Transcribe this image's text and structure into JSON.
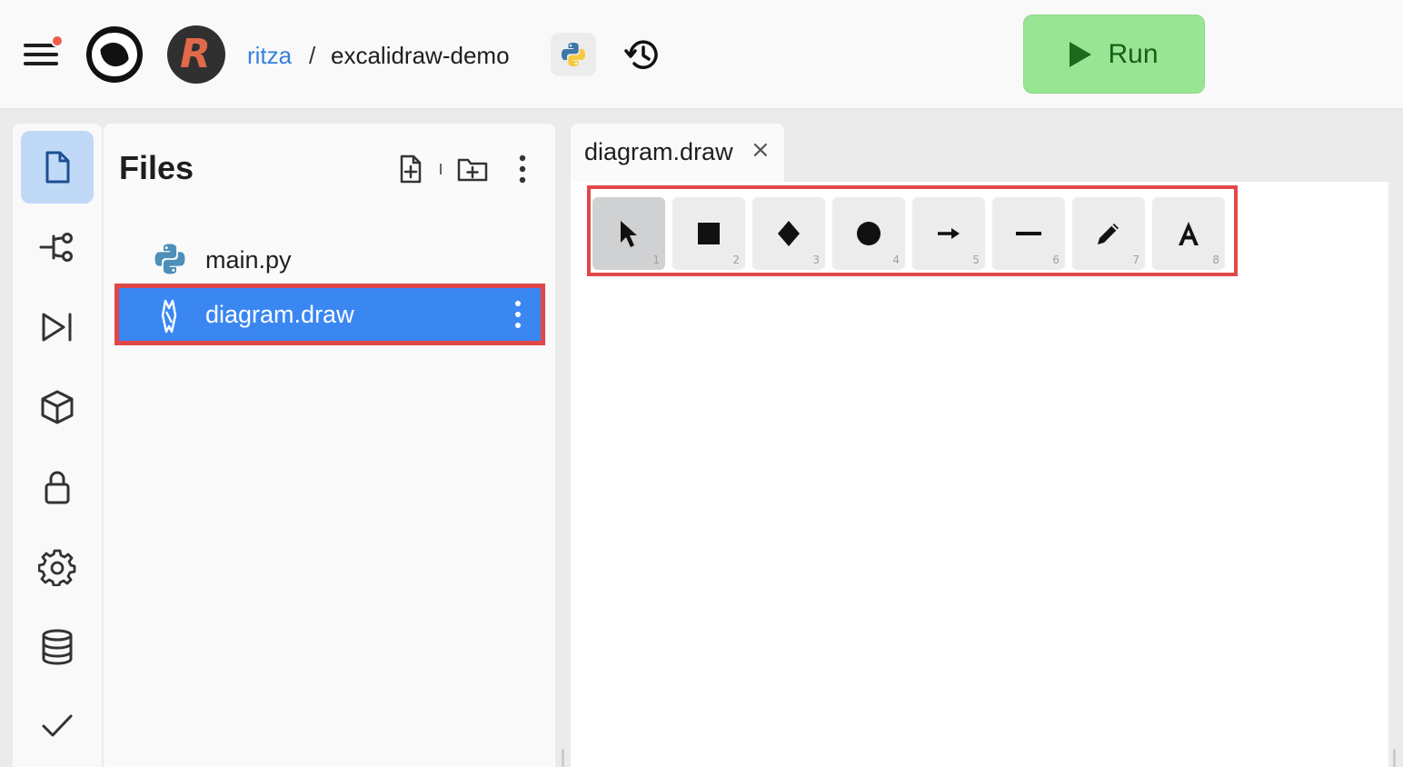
{
  "header": {
    "owner": "ritza",
    "separator": "/",
    "repl_name": "excalidraw-demo",
    "run_label": "Run",
    "avatar_letter": "R",
    "accent_color": "#3580e0",
    "run_color": "#98e693"
  },
  "rail": {
    "items": [
      {
        "icon": "file-icon",
        "active": true
      },
      {
        "icon": "git-branch-icon",
        "active": false
      },
      {
        "icon": "debugger-icon",
        "active": false
      },
      {
        "icon": "package-icon",
        "active": false
      },
      {
        "icon": "lock-icon",
        "active": false
      },
      {
        "icon": "gear-icon",
        "active": false
      },
      {
        "icon": "database-icon",
        "active": false
      },
      {
        "icon": "checkmark-icon",
        "active": false
      }
    ]
  },
  "files": {
    "title": "Files",
    "items": [
      {
        "name": "main.py",
        "icon": "python-icon",
        "selected": false
      },
      {
        "name": "diagram.draw",
        "icon": "excalidraw-icon",
        "selected": true
      }
    ]
  },
  "editor": {
    "tab_label": "diagram.draw",
    "close_glyph": "×"
  },
  "toolbar": {
    "tools": [
      {
        "name": "selection",
        "key": "1",
        "active": true
      },
      {
        "name": "rectangle",
        "key": "2",
        "active": false
      },
      {
        "name": "diamond",
        "key": "3",
        "active": false
      },
      {
        "name": "ellipse",
        "key": "4",
        "active": false
      },
      {
        "name": "arrow",
        "key": "5",
        "active": false
      },
      {
        "name": "line",
        "key": "6",
        "active": false
      },
      {
        "name": "draw",
        "key": "7",
        "active": false
      },
      {
        "name": "text",
        "key": "8",
        "active": false
      }
    ]
  }
}
